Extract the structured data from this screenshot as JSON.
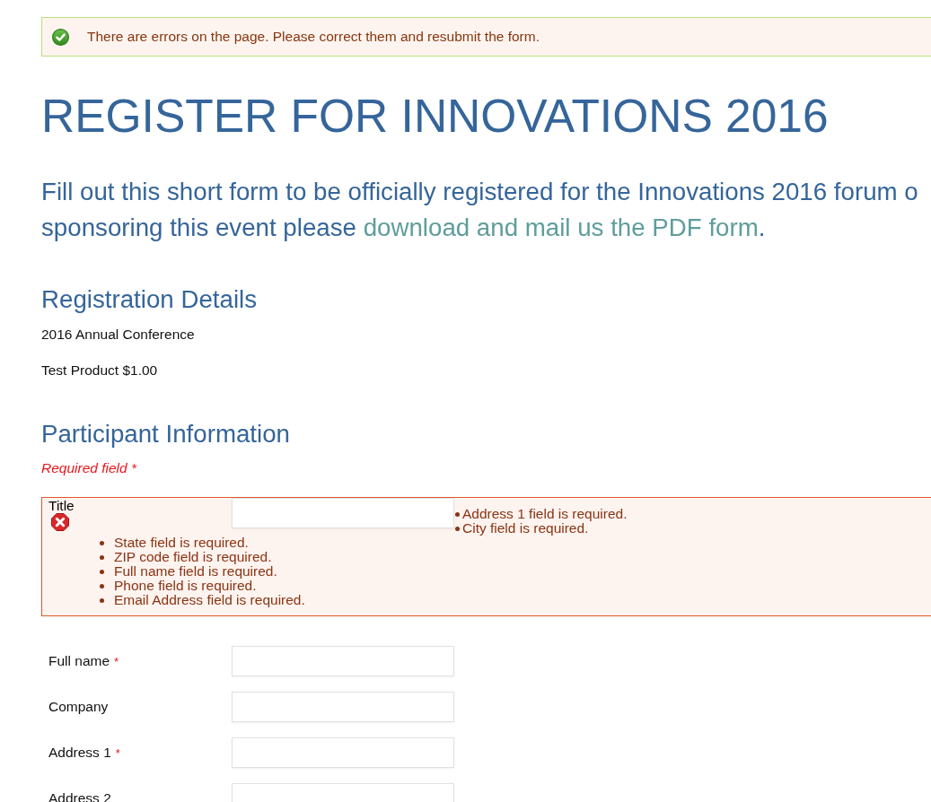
{
  "alert": {
    "message": "There are errors on the page. Please correct them and resubmit the form."
  },
  "title": "REGISTER FOR INNOVATIONS 2016",
  "intro": {
    "line_1": "Fill out this short form to be officially registered for the Innovations 2016 forum o",
    "line_2": "sponsoring this event please",
    "link": "download and mail us the PDF form",
    "after_link": "."
  },
  "registration": {
    "heading": "Registration Details",
    "items": [
      "2016 Annual Conference",
      "Test Product $1.00"
    ]
  },
  "participant": {
    "heading": "Participant Information",
    "legend": "Required field *",
    "title_field": {
      "label": "Title"
    },
    "errors": {
      "beside": [
        "Address 1 field is required.",
        "City field is required."
      ],
      "below": [
        "State field is required.",
        "ZIP code field is required.",
        "Full name field is required.",
        "Phone field is required.",
        "Email Address field is required."
      ]
    },
    "fields": [
      {
        "label": "Full name",
        "required_mark": "*"
      },
      {
        "label": "Company"
      },
      {
        "label": "Address 1",
        "required_mark": "*"
      },
      {
        "label": "Address 2"
      }
    ]
  }
}
